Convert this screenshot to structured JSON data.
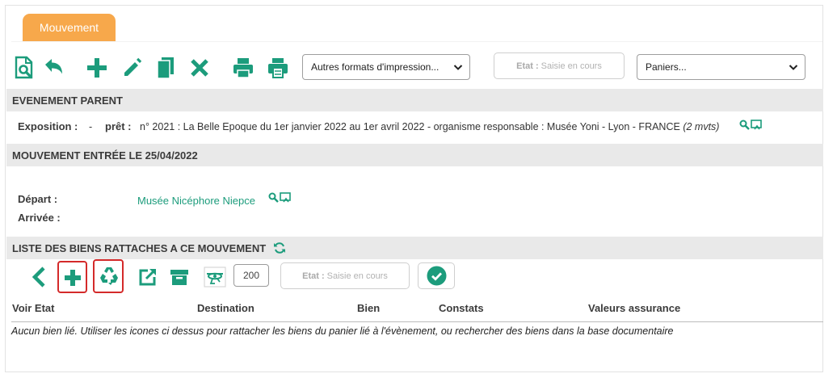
{
  "tab": {
    "label": "Mouvement"
  },
  "toolbar": {
    "icons": [
      "search-document-icon",
      "back-arrow-icon",
      "plus-icon",
      "pencil-icon",
      "copy-icon",
      "close-icon",
      "print-icon",
      "print-alt-icon"
    ],
    "print_formats_select": "Autres formats d'impression...",
    "state_label": "Etat :",
    "state_value": "Saisie en cours",
    "baskets_select": "Paniers..."
  },
  "parent_event": {
    "heading": "EVENEMENT PARENT",
    "exposition_label": "Exposition :",
    "exposition_value": "-",
    "loan_label": "prêt :",
    "loan_text": "n° 2021 : La Belle Epoque du 1er janvier 2022 au 1er avril 2022 - organisme responsable : Musée Yoni - Lyon - FRANCE",
    "loan_count": "(2 mvts)"
  },
  "movement": {
    "heading": "MOUVEMENT ENTRÉE LE 25/04/2022",
    "departure_label": "Départ :",
    "departure_value": "Musée Nicéphore Niepce",
    "arrival_label": "Arrivée :"
  },
  "assets": {
    "heading": "LISTE DES BIENS RATTACHES A CE MOUVEMENT",
    "quantity": "200",
    "state_label": "Etat :",
    "state_value": "Saisie en cours",
    "columns": [
      "Voir Etat",
      "Destination",
      "Bien",
      "Constats",
      "Valeurs assurance"
    ],
    "empty_message": "Aucun bien lié. Utiliser les icones ci dessus pour rattacher les biens du panier lié à l'évènement, ou rechercher des biens dans la base documentaire"
  },
  "colors": {
    "accent": "#1c9c7c",
    "tab": "#f7a84b",
    "section_bg": "#e9e9e9",
    "highlight": "#d42a2a"
  }
}
